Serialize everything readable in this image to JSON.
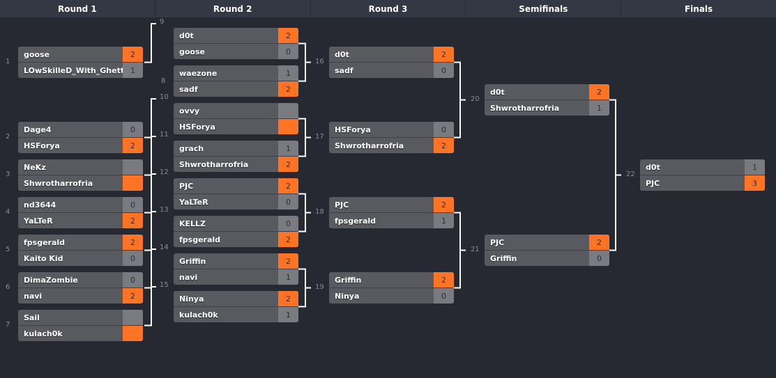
{
  "rounds": [
    "Round 1",
    "Round 2",
    "Round 3",
    "Semifinals",
    "Finals"
  ],
  "matches": [
    {
      "id": "1",
      "round": 0,
      "slot": 0,
      "players": [
        {
          "name": "goose",
          "score": "2",
          "win": true
        },
        {
          "name": "LOwSkilleD_With_GhettoBlaster",
          "score": "1",
          "win": false
        }
      ]
    },
    {
      "id": "2",
      "round": 0,
      "slot": 1,
      "players": [
        {
          "name": "Dage4",
          "score": "0",
          "win": false
        },
        {
          "name": "HSForya",
          "score": "2",
          "win": true
        }
      ]
    },
    {
      "id": "3",
      "round": 0,
      "slot": 2,
      "players": [
        {
          "name": "NeKz",
          "score": "",
          "win": false
        },
        {
          "name": "Shwrotharrofria",
          "score": "",
          "win": true
        }
      ]
    },
    {
      "id": "4",
      "round": 0,
      "slot": 3,
      "players": [
        {
          "name": "nd3644",
          "score": "0",
          "win": false
        },
        {
          "name": "YaLTeR",
          "score": "2",
          "win": true
        }
      ]
    },
    {
      "id": "5",
      "round": 0,
      "slot": 4,
      "players": [
        {
          "name": "fpsgerald",
          "score": "2",
          "win": true
        },
        {
          "name": "Kaito Kid",
          "score": "0",
          "win": false
        }
      ]
    },
    {
      "id": "6",
      "round": 0,
      "slot": 5,
      "players": [
        {
          "name": "DimaZombie",
          "score": "0",
          "win": false
        },
        {
          "name": "navi",
          "score": "2",
          "win": true
        }
      ]
    },
    {
      "id": "7",
      "round": 0,
      "slot": 6,
      "players": [
        {
          "name": "Sail",
          "score": "",
          "win": false
        },
        {
          "name": "kulach0k",
          "score": "",
          "win": true
        }
      ]
    },
    {
      "id": "9",
      "round": 1,
      "slot": 0,
      "players": [
        {
          "name": "d0t",
          "score": "2",
          "win": true
        },
        {
          "name": "goose",
          "score": "0",
          "win": false
        }
      ]
    },
    {
      "id": "8",
      "round": 1,
      "slot": 1,
      "players": [
        {
          "name": "waezone",
          "score": "1",
          "win": false
        },
        {
          "name": "sadf",
          "score": "2",
          "win": true
        }
      ]
    },
    {
      "id": "10",
      "round": 1,
      "slot": 2,
      "players": [
        {
          "name": "ovvy",
          "score": "",
          "win": false
        },
        {
          "name": "HSForya",
          "score": "",
          "win": true
        }
      ]
    },
    {
      "id": "11",
      "round": 1,
      "slot": 3,
      "players": [
        {
          "name": "grach",
          "score": "1",
          "win": false
        },
        {
          "name": "Shwrotharrofria",
          "score": "2",
          "win": true
        }
      ]
    },
    {
      "id": "12",
      "round": 1,
      "slot": 4,
      "players": [
        {
          "name": "PJC",
          "score": "2",
          "win": true
        },
        {
          "name": "YaLTeR",
          "score": "0",
          "win": false
        }
      ]
    },
    {
      "id": "13",
      "round": 1,
      "slot": 5,
      "players": [
        {
          "name": "KELLZ",
          "score": "0",
          "win": false
        },
        {
          "name": "fpsgerald",
          "score": "2",
          "win": true
        }
      ]
    },
    {
      "id": "14",
      "round": 1,
      "slot": 6,
      "players": [
        {
          "name": "Griffin",
          "score": "2",
          "win": true
        },
        {
          "name": "navi",
          "score": "1",
          "win": false
        }
      ]
    },
    {
      "id": "15",
      "round": 1,
      "slot": 7,
      "players": [
        {
          "name": "Ninya",
          "score": "2",
          "win": true
        },
        {
          "name": "kulach0k",
          "score": "1",
          "win": false
        }
      ]
    },
    {
      "id": "16",
      "round": 2,
      "slot": 0,
      "players": [
        {
          "name": "d0t",
          "score": "2",
          "win": true
        },
        {
          "name": "sadf",
          "score": "0",
          "win": false
        }
      ]
    },
    {
      "id": "17",
      "round": 2,
      "slot": 1,
      "players": [
        {
          "name": "HSForya",
          "score": "0",
          "win": false
        },
        {
          "name": "Shwrotharrofria",
          "score": "2",
          "win": true
        }
      ]
    },
    {
      "id": "18",
      "round": 2,
      "slot": 2,
      "players": [
        {
          "name": "PJC",
          "score": "2",
          "win": true
        },
        {
          "name": "fpsgerald",
          "score": "1",
          "win": false
        }
      ]
    },
    {
      "id": "19",
      "round": 2,
      "slot": 3,
      "players": [
        {
          "name": "Griffin",
          "score": "2",
          "win": true
        },
        {
          "name": "Ninya",
          "score": "0",
          "win": false
        }
      ]
    },
    {
      "id": "20",
      "round": 3,
      "slot": 0,
      "players": [
        {
          "name": "d0t",
          "score": "2",
          "win": true
        },
        {
          "name": "Shwrotharrofria",
          "score": "1",
          "win": false
        }
      ]
    },
    {
      "id": "21",
      "round": 3,
      "slot": 1,
      "players": [
        {
          "name": "PJC",
          "score": "2",
          "win": true
        },
        {
          "name": "Griffin",
          "score": "0",
          "win": false
        }
      ]
    },
    {
      "id": "22",
      "round": 4,
      "slot": 0,
      "players": [
        {
          "name": "d0t",
          "score": "1",
          "win": false
        },
        {
          "name": "PJC",
          "score": "3",
          "win": true
        }
      ]
    }
  ],
  "colors": {
    "winner": "#ff7324",
    "loser": "#7a7b80",
    "row": "#585a60",
    "background": "#272932",
    "header": "#343744"
  }
}
